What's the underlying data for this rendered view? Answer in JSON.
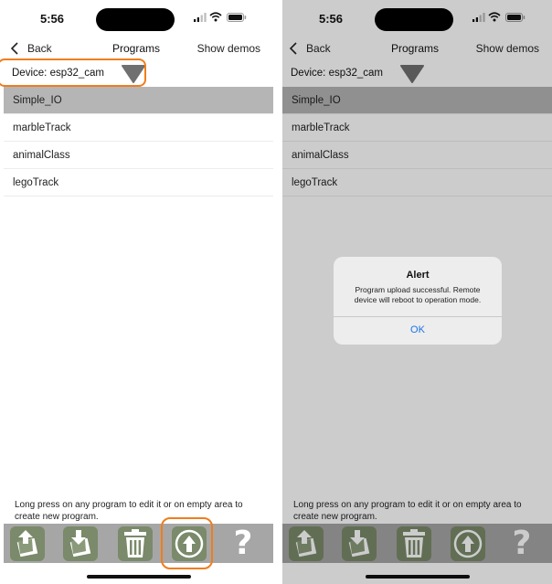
{
  "status": {
    "time": "5:56"
  },
  "nav": {
    "back_label": "Back",
    "title": "Programs",
    "show_demos": "Show demos"
  },
  "device": {
    "label": "Device:",
    "value": "esp32_cam"
  },
  "programs": [
    "Simple_IO",
    "marbleTrack",
    "animalClass",
    "legoTrack"
  ],
  "hint": "Long press on any program to edit it or on empty area to create new program.",
  "toolbar": {
    "icons": [
      "upload-to-file-icon",
      "download-from-file-icon",
      "trash-icon",
      "upload-program-icon",
      "help-icon"
    ],
    "help_label": "?"
  },
  "alert": {
    "title": "Alert",
    "message": "Program upload successful. Remote device will reboot to operation mode.",
    "ok": "OK"
  },
  "colors": {
    "highlight": "#f07d1c",
    "selected_row": "#b5b5b5",
    "toolbar_bg": "#a6a6a6",
    "button_bg": "#7a8a6a",
    "alert_button": "#1a73e8"
  }
}
